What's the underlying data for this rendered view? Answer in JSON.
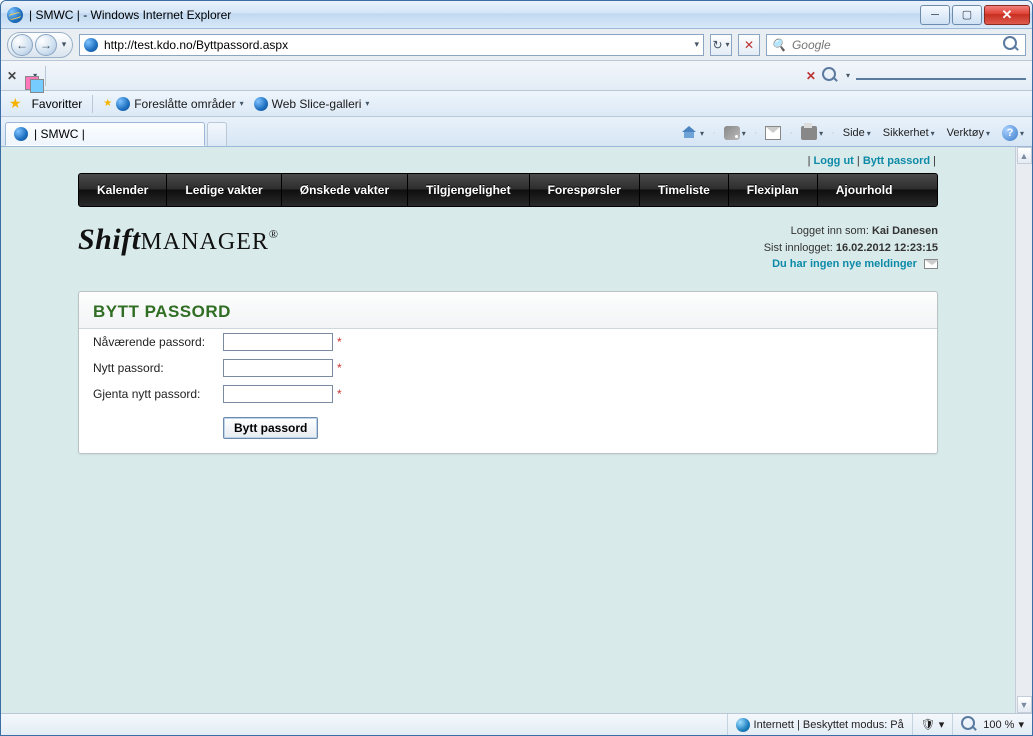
{
  "window": {
    "title": "| SMWC | - Windows Internet Explorer"
  },
  "addressbar": {
    "url": "http://test.kdo.no/Byttpassord.aspx"
  },
  "search": {
    "placeholder": "Google"
  },
  "favbar": {
    "favorites": "Favoritter",
    "suggested": "Foreslåtte områder",
    "slice": "Web Slice-galleri"
  },
  "tab": {
    "title": "| SMWC |"
  },
  "cmdbar": {
    "page": "Side",
    "safety": "Sikkerhet",
    "tools": "Verktøy"
  },
  "topLinks": {
    "logout": "Logg ut",
    "changePw": "Bytt passord"
  },
  "menu": {
    "items": [
      "Kalender",
      "Ledige vakter",
      "Ønskede vakter",
      "Tilgjengelighet",
      "Forespørsler",
      "Timeliste",
      "Flexiplan",
      "Ajourhold"
    ]
  },
  "logo": {
    "bold": "Shift",
    "thin": "MANAGER",
    "reg": "®"
  },
  "userinfo": {
    "loggedInAsLabel": "Logget inn som: ",
    "userName": "Kai Danesen",
    "lastLoginLabel": "Sist innlogget: ",
    "lastLoginValue": "16.02.2012 12:23:15",
    "noMessages": "Du har ingen nye meldinger"
  },
  "panel": {
    "title": "BYTT PASSORD",
    "currentLabel": "Nåværende passord:",
    "newLabel": "Nytt passord:",
    "repeatLabel": "Gjenta nytt passord:",
    "submit": "Bytt passord"
  },
  "status": {
    "zoneText": "Internett | Beskyttet modus: På",
    "zoom": "100 %"
  }
}
